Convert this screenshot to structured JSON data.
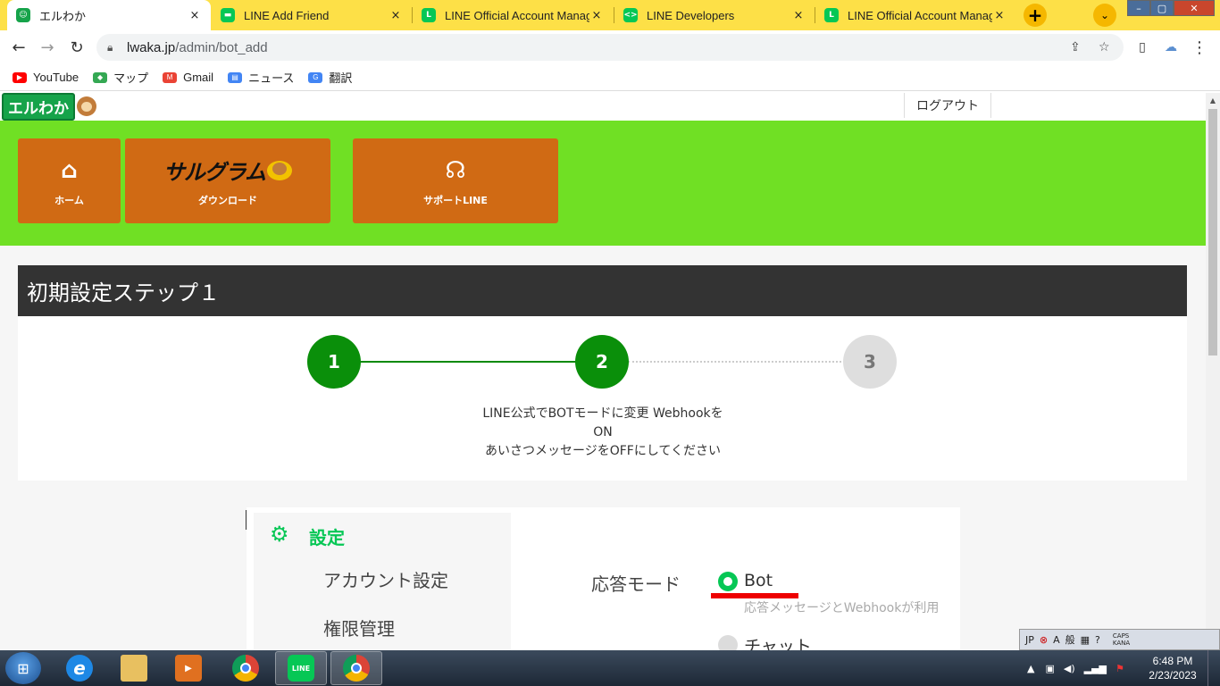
{
  "browser": {
    "tabs": [
      {
        "title": "エルわか",
        "favicon": "robot-favicon",
        "color": "#16a34a",
        "active": true
      },
      {
        "title": "LINE Add Friend",
        "favicon": "line-favicon",
        "color": "#06c755",
        "active": false
      },
      {
        "title": "LINE Official Account Manager",
        "favicon": "line-oa-favicon",
        "color": "#06c755",
        "active": false
      },
      {
        "title": "LINE Developers",
        "favicon": "code-favicon",
        "color": "#06c755",
        "active": false
      },
      {
        "title": "LINE Official Account Manager",
        "favicon": "line-oa-favicon",
        "color": "#06c755",
        "active": false
      }
    ],
    "close_glyph": "×",
    "new_tab_glyph": "+",
    "tab_search_glyph": "⌄",
    "window_controls": [
      "–",
      "▢",
      "✕"
    ],
    "url_host": "lwaka.jp",
    "url_path": "/admin/bot_add",
    "bookmarks": [
      {
        "label": "YouTube",
        "icon": "youtube-icon",
        "color": "#ff0000"
      },
      {
        "label": "マップ",
        "icon": "maps-icon",
        "color": "#34a853"
      },
      {
        "label": "Gmail",
        "icon": "gmail-icon",
        "color": "#ea4335"
      },
      {
        "label": "ニュース",
        "icon": "news-icon",
        "color": "#4285f4"
      },
      {
        "label": "翻訳",
        "icon": "translate-icon",
        "color": "#4285f4"
      }
    ]
  },
  "site": {
    "logo_text": "エルわか",
    "logout_label": "ログアウト",
    "menu": [
      {
        "label": "ホーム",
        "icon": "home-icon",
        "glyph": "⌂"
      },
      {
        "label": "ダウンロード",
        "icon": "sarugram-logo",
        "logo_text": "サルグラム"
      },
      {
        "label": "サポートLINE",
        "icon": "headset-icon",
        "glyph": "☊"
      }
    ],
    "accent_green": "#70e024",
    "menu_orange": "#d06a14"
  },
  "page": {
    "step_title": "初期設定ステップ１",
    "steps": [
      {
        "number": "1",
        "state": "done"
      },
      {
        "number": "2",
        "state": "current"
      },
      {
        "number": "3",
        "state": "pending"
      }
    ],
    "instruction_lines": [
      "LINE公式でBOTモードに変更 Webhookを",
      "ON",
      "あいさつメッセージをOFFにしてください"
    ]
  },
  "screenshot": {
    "section_title": "設定",
    "sidebar_items": [
      "アカウント設定",
      "権限管理"
    ],
    "mode_label": "応答モード",
    "options": [
      {
        "label": "Bot",
        "selected": true
      },
      {
        "label": "チャット",
        "selected": false
      }
    ],
    "note": "応答メッセージとWebhookが利用"
  },
  "ime": {
    "items": [
      "JP",
      "A",
      "般"
    ],
    "caps": "CAPS",
    "kana": "KANA"
  },
  "taskbar": {
    "apps": [
      {
        "name": "internet-explorer",
        "label": "e",
        "color": "#1e88e5"
      },
      {
        "name": "file-explorer",
        "label": "",
        "color": "#e8c060"
      },
      {
        "name": "media-player",
        "label": "▶",
        "color": "#e07020"
      },
      {
        "name": "chrome",
        "label": "",
        "color": "#db4437"
      },
      {
        "name": "line",
        "label": "LINE",
        "color": "#06c755"
      },
      {
        "name": "chrome-active",
        "label": "",
        "color": "#db4437"
      }
    ],
    "time": "6:48 PM",
    "date": "2/23/2023"
  }
}
